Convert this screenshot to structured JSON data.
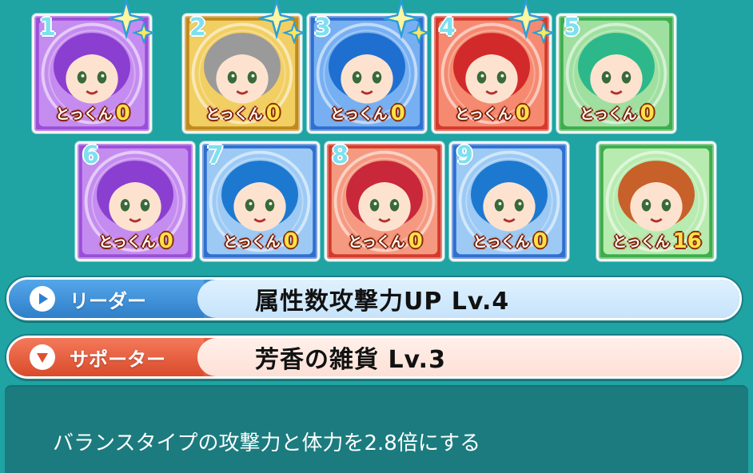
{
  "deck": {
    "cards": [
      {
        "num": "1",
        "tokkun_label": "とっくん",
        "tokkun_value": "0",
        "frame_color": "#9b4fd8",
        "inner_color": "#c58cf0",
        "hair_color": "#8a3fd0",
        "sparkle": true
      },
      {
        "num": "2",
        "tokkun_label": "とっくん",
        "tokkun_value": "0",
        "frame_color": "#c08a1c",
        "inner_color": "#f2cf63",
        "hair_color": "#9a9a9a",
        "sparkle": true
      },
      {
        "num": "3",
        "tokkun_label": "とっくん",
        "tokkun_value": "0",
        "frame_color": "#2f6fd0",
        "inner_color": "#77b0f2",
        "hair_color": "#1f6fd0",
        "sparkle": true
      },
      {
        "num": "4",
        "tokkun_label": "とっくん",
        "tokkun_value": "0",
        "frame_color": "#d43a2a",
        "inner_color": "#f58a70",
        "hair_color": "#d22a2a",
        "sparkle": true
      },
      {
        "num": "5",
        "tokkun_label": "とっくん",
        "tokkun_value": "0",
        "frame_color": "#3cae4c",
        "inner_color": "#9fe0a0",
        "hair_color": "#2cb88a",
        "sparkle": false
      },
      {
        "num": "6",
        "tokkun_label": "とっくん",
        "tokkun_value": "0",
        "frame_color": "#9b4fd8",
        "inner_color": "#c58cf0",
        "hair_color": "#8a3fd0",
        "sparkle": false
      },
      {
        "num": "7",
        "tokkun_label": "とっくん",
        "tokkun_value": "0",
        "frame_color": "#2f6fd0",
        "inner_color": "#9ccaf5",
        "hair_color": "#1d78d0",
        "sparkle": false
      },
      {
        "num": "8",
        "tokkun_label": "とっくん",
        "tokkun_value": "0",
        "frame_color": "#d43a2a",
        "inner_color": "#f59a80",
        "hair_color": "#c8283a",
        "sparkle": false
      },
      {
        "num": "9",
        "tokkun_label": "とっくん",
        "tokkun_value": "0",
        "frame_color": "#2f6fd0",
        "inner_color": "#9ccaf5",
        "hair_color": "#1d78d0",
        "sparkle": false
      },
      {
        "num": "",
        "tokkun_label": "とっくん",
        "tokkun_value": "16",
        "frame_color": "#3cae4c",
        "inner_color": "#b8ebb0",
        "hair_color": "#c8602a",
        "sparkle": false
      }
    ]
  },
  "leader": {
    "label": "リーダー",
    "skill": "属性数攻撃力UP Lv.4",
    "icon": "play-icon"
  },
  "supporter": {
    "label": "サポーター",
    "skill": "芳香の雑貨 Lv.3",
    "icon": "triangle-down-icon"
  },
  "description": "バランスタイプの攻撃力と体力を2.8倍にする"
}
